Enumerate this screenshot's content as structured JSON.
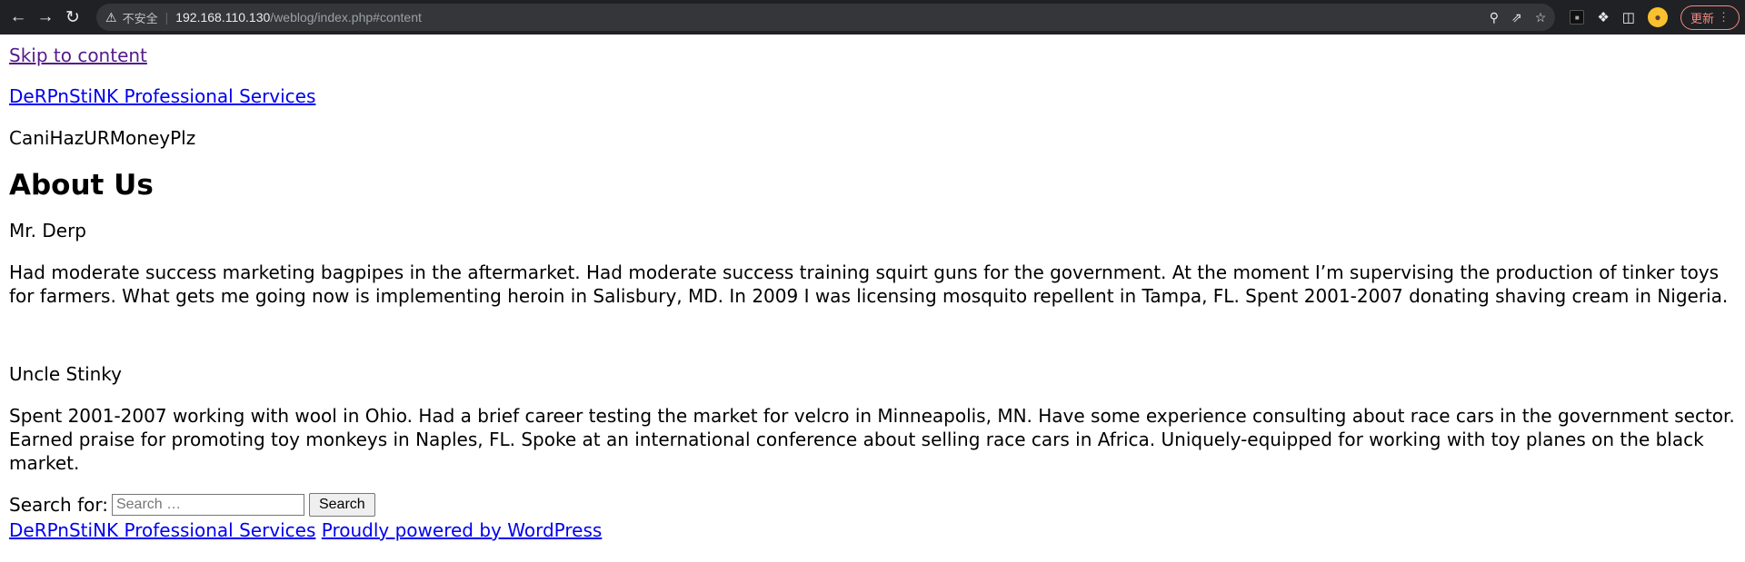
{
  "browser": {
    "insecure_label": "不安全",
    "url_host": "192.168.110.130",
    "url_path": "/weblog/index.php#content",
    "update_label": "更新"
  },
  "page": {
    "skip_link": "Skip to content",
    "site_title": "DeRPnStiNK Professional Services",
    "tagline": "CaniHazURMoneyPlz",
    "heading": "About Us",
    "people": [
      {
        "name": "Mr. Derp",
        "bio": "Had moderate success marketing bagpipes in the aftermarket. Had moderate success training squirt guns for the government. At the moment I’m supervising the production of tinker toys for farmers. What gets me going now is implementing heroin in Salisbury, MD. In 2009 I was licensing mosquito repellent in Tampa, FL. Spent 2001-2007 donating shaving cream in Nigeria."
      },
      {
        "name": "Uncle Stinky",
        "bio": "Spent 2001-2007 working with wool in Ohio. Had a brief career testing the market for velcro in Minneapolis, MN. Have some experience consulting about race cars in the government sector. Earned praise for promoting toy monkeys in Naples, FL. Spoke at an international conference about selling race cars in Africa. Uniquely-equipped for working with toy planes on the black market."
      }
    ],
    "search": {
      "label": "Search for:",
      "placeholder": "Search …",
      "button": "Search"
    },
    "footer": {
      "site_link": "DeRPnStiNK Professional Services",
      "powered_link": "Proudly powered by WordPress"
    }
  }
}
